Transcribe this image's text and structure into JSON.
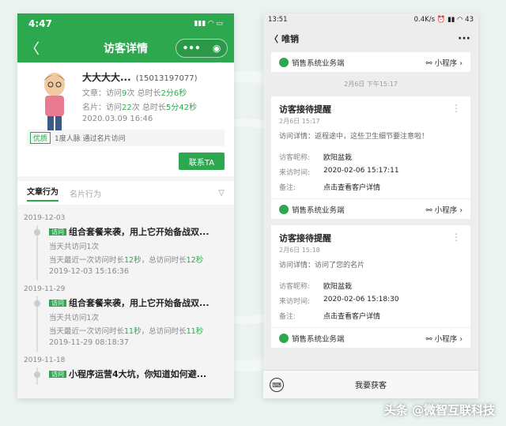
{
  "left": {
    "status": {
      "time": "4:47",
      "icons": "▮▮▮ ◠ ▭"
    },
    "nav": {
      "title": "访客详情",
      "back": "〈",
      "capsule_more": "•••",
      "capsule_close": "◉"
    },
    "profile": {
      "name": "大大大大...",
      "phone": "(15013197077)",
      "article_label": "文章：访问",
      "article_visits": "9",
      "article_mid": "次 总时长",
      "article_duration": "2分6秒",
      "card_label": "名片：访问",
      "card_visits": "22",
      "card_mid": "次 总时长",
      "card_duration": "5分42秒",
      "timestamp": "2020.03.09 16:46",
      "tag": "优质",
      "tag_text": "1度人脉  通过名片访问",
      "contact_button": "联系TA"
    },
    "tabs": [
      "文章行为",
      "名片行为"
    ],
    "timeline": [
      {
        "date": "2019-12-03",
        "badge": "访问",
        "title": "组合套餐来袭，用上它开始备战双...",
        "line1": "当天共访问1次",
        "line2_a": "当天最近一次访问时长",
        "line2_v1": "12秒",
        "line2_b": "，总访问时长",
        "line2_v2": "12秒",
        "time": "2019-12-03 15:16:36"
      },
      {
        "date": "2019-11-29",
        "badge": "访问",
        "title": "组合套餐来袭，用上它开始备战双...",
        "line1": "当天共访问1次",
        "line2_a": "当天最近一次访问时长",
        "line2_v1": "11秒",
        "line2_b": "，总访问时长",
        "line2_v2": "11秒",
        "time": "2019-11-29 08:18:37"
      },
      {
        "date": "2019-11-18",
        "badge": "访问",
        "title": "小程序运营4大坑，你知道如何避..."
      }
    ]
  },
  "right": {
    "status": {
      "time": "13:51",
      "icons": "0.4K/s ⏰ ▮▮ ◠ 43"
    },
    "nav": {
      "title": "唯销",
      "back": "〈",
      "more": "···"
    },
    "top_footer": {
      "app": "销售系统业务端",
      "mini": "小程序"
    },
    "timestamp": "2月6日 下午15:17",
    "cards": [
      {
        "title": "访客接待提醒",
        "date": "2月6日 15:17",
        "desc": "访问详情：返程途中，这些卫生细节要注意啦！",
        "nick_k": "访客昵称:",
        "nick_v": "欧阳盆栽",
        "time_k": "来访时间:",
        "time_v": "2020-02-06 15:17:11",
        "note_k": "备注:",
        "note_v": "点击查看客户详情",
        "footer_app": "销售系统业务端",
        "footer_mini": "小程序"
      },
      {
        "title": "访客接待提醒",
        "date": "2月6日 15:18",
        "desc": "访问详情：访问了您的名片",
        "nick_k": "访客昵称:",
        "nick_v": "欧阳盆栽",
        "time_k": "来访时间:",
        "time_v": "2020-02-06 15:18:30",
        "note_k": "备注:",
        "note_v": "点击查看客户详情",
        "footer_app": "销售系统业务端",
        "footer_mini": "小程序"
      }
    ],
    "bottom_label": "我要获客"
  },
  "watermark": "头条 @微智互联科技",
  "colors": {
    "accent": "#2ea84f"
  }
}
